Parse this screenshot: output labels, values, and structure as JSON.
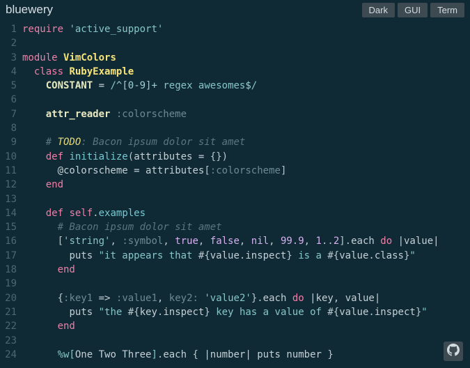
{
  "header": {
    "title": "bluewery",
    "tabs": [
      {
        "label": "Dark"
      },
      {
        "label": "GUI"
      },
      {
        "label": "Term"
      }
    ]
  },
  "code": {
    "lines": [
      {
        "n": 1,
        "t": [
          [
            "kw",
            "require"
          ],
          [
            "punc",
            " "
          ],
          [
            "str",
            "'active_support'"
          ]
        ]
      },
      {
        "n": 2,
        "t": []
      },
      {
        "n": 3,
        "t": [
          [
            "kw",
            "module"
          ],
          [
            "punc",
            " "
          ],
          [
            "cls",
            "VimColors"
          ]
        ]
      },
      {
        "n": 4,
        "t": [
          [
            "punc",
            "  "
          ],
          [
            "kw",
            "class"
          ],
          [
            "punc",
            " "
          ],
          [
            "cls",
            "RubyExample"
          ]
        ]
      },
      {
        "n": 5,
        "t": [
          [
            "punc",
            "    "
          ],
          [
            "mac",
            "CONSTANT"
          ],
          [
            "punc",
            " "
          ],
          [
            "id",
            "="
          ],
          [
            "punc",
            " "
          ],
          [
            "rgx",
            "/"
          ],
          [
            "rgxi",
            "^[0-9]+"
          ],
          [
            "rgx",
            " regex awesomes"
          ],
          [
            "rgxi",
            "$"
          ],
          [
            "rgx",
            "/"
          ]
        ]
      },
      {
        "n": 6,
        "t": []
      },
      {
        "n": 7,
        "t": [
          [
            "punc",
            "    "
          ],
          [
            "mac",
            "attr_reader"
          ],
          [
            "punc",
            " "
          ],
          [
            "sym",
            ":colorscheme"
          ]
        ]
      },
      {
        "n": 8,
        "t": []
      },
      {
        "n": 9,
        "t": [
          [
            "punc",
            "    "
          ],
          [
            "cmt",
            "# "
          ],
          [
            "todo",
            "TODO"
          ],
          [
            "cmt",
            ": Bacon ipsum dolor sit amet"
          ]
        ]
      },
      {
        "n": 10,
        "t": [
          [
            "punc",
            "    "
          ],
          [
            "kw",
            "def"
          ],
          [
            "punc",
            " "
          ],
          [
            "fn",
            "initialize"
          ],
          [
            "punc",
            "("
          ],
          [
            "id",
            "attributes"
          ],
          [
            "punc",
            " "
          ],
          [
            "id",
            "="
          ],
          [
            "punc",
            " {})"
          ]
        ]
      },
      {
        "n": 11,
        "t": [
          [
            "punc",
            "      "
          ],
          [
            "id",
            "@colorscheme"
          ],
          [
            "punc",
            " "
          ],
          [
            "id",
            "="
          ],
          [
            "punc",
            " "
          ],
          [
            "id",
            "attributes"
          ],
          [
            "punc",
            "["
          ],
          [
            "sym",
            ":colorscheme"
          ],
          [
            "punc",
            "]"
          ]
        ]
      },
      {
        "n": 12,
        "t": [
          [
            "punc",
            "    "
          ],
          [
            "kw",
            "end"
          ]
        ]
      },
      {
        "n": 13,
        "t": []
      },
      {
        "n": 14,
        "t": [
          [
            "punc",
            "    "
          ],
          [
            "kw",
            "def"
          ],
          [
            "punc",
            " "
          ],
          [
            "kw",
            "self"
          ],
          [
            "punc",
            "."
          ],
          [
            "fn",
            "examples"
          ]
        ]
      },
      {
        "n": 15,
        "t": [
          [
            "punc",
            "      "
          ],
          [
            "cmt",
            "# Bacon ipsum dolor sit amet"
          ]
        ]
      },
      {
        "n": 16,
        "t": [
          [
            "punc",
            "      ["
          ],
          [
            "str",
            "'string'"
          ],
          [
            "punc",
            ", "
          ],
          [
            "sym",
            ":symbol"
          ],
          [
            "punc",
            ", "
          ],
          [
            "bool",
            "true"
          ],
          [
            "punc",
            ", "
          ],
          [
            "bool",
            "false"
          ],
          [
            "punc",
            ", "
          ],
          [
            "bool",
            "nil"
          ],
          [
            "punc",
            ", "
          ],
          [
            "num",
            "99.9"
          ],
          [
            "punc",
            ", "
          ],
          [
            "num",
            "1"
          ],
          [
            "punc",
            ".."
          ],
          [
            "num",
            "2"
          ],
          [
            "punc",
            "]."
          ],
          [
            "id",
            "each"
          ],
          [
            "punc",
            " "
          ],
          [
            "kw",
            "do"
          ],
          [
            "punc",
            " "
          ],
          [
            "pipe",
            "|"
          ],
          [
            "id",
            "value"
          ],
          [
            "pipe",
            "|"
          ]
        ]
      },
      {
        "n": 17,
        "t": [
          [
            "punc",
            "        "
          ],
          [
            "id",
            "puts"
          ],
          [
            "punc",
            " "
          ],
          [
            "str",
            "\"it appears that "
          ],
          [
            "punc",
            "#{"
          ],
          [
            "id",
            "value"
          ],
          [
            "punc",
            "."
          ],
          [
            "id",
            "inspect"
          ],
          [
            "punc",
            "}"
          ],
          [
            "str",
            " is a "
          ],
          [
            "punc",
            "#{"
          ],
          [
            "id",
            "value"
          ],
          [
            "punc",
            "."
          ],
          [
            "id",
            "class"
          ],
          [
            "punc",
            "}"
          ],
          [
            "str",
            "\""
          ]
        ]
      },
      {
        "n": 18,
        "t": [
          [
            "punc",
            "      "
          ],
          [
            "kw",
            "end"
          ]
        ]
      },
      {
        "n": 19,
        "t": []
      },
      {
        "n": 20,
        "t": [
          [
            "punc",
            "      {"
          ],
          [
            "sym",
            ":key1"
          ],
          [
            "punc",
            " "
          ],
          [
            "id",
            "=>"
          ],
          [
            "punc",
            " "
          ],
          [
            "sym",
            ":value1"
          ],
          [
            "punc",
            ", "
          ],
          [
            "sym",
            "key2:"
          ],
          [
            "punc",
            " "
          ],
          [
            "str",
            "'value2'"
          ],
          [
            "punc",
            "}."
          ],
          [
            "id",
            "each"
          ],
          [
            "punc",
            " "
          ],
          [
            "kw",
            "do"
          ],
          [
            "punc",
            " "
          ],
          [
            "pipe",
            "|"
          ],
          [
            "id",
            "key"
          ],
          [
            "punc",
            ", "
          ],
          [
            "id",
            "value"
          ],
          [
            "pipe",
            "|"
          ]
        ]
      },
      {
        "n": 21,
        "t": [
          [
            "punc",
            "        "
          ],
          [
            "id",
            "puts"
          ],
          [
            "punc",
            " "
          ],
          [
            "str",
            "\"the "
          ],
          [
            "punc",
            "#{"
          ],
          [
            "id",
            "key"
          ],
          [
            "punc",
            "."
          ],
          [
            "id",
            "inspect"
          ],
          [
            "punc",
            "}"
          ],
          [
            "str",
            " key has a value of "
          ],
          [
            "punc",
            "#{"
          ],
          [
            "id",
            "value"
          ],
          [
            "punc",
            "."
          ],
          [
            "id",
            "inspect"
          ],
          [
            "punc",
            "}"
          ],
          [
            "str",
            "\""
          ]
        ]
      },
      {
        "n": 22,
        "t": [
          [
            "punc",
            "      "
          ],
          [
            "kw",
            "end"
          ]
        ]
      },
      {
        "n": 23,
        "t": []
      },
      {
        "n": 24,
        "t": [
          [
            "punc",
            "      "
          ],
          [
            "rgx",
            "%w["
          ],
          [
            "id",
            "One Two Three"
          ],
          [
            "rgx",
            "]"
          ],
          [
            "punc",
            "."
          ],
          [
            "id",
            "each"
          ],
          [
            "punc",
            " { "
          ],
          [
            "pipe",
            "|"
          ],
          [
            "id",
            "number"
          ],
          [
            "pipe",
            "|"
          ],
          [
            "punc",
            " "
          ],
          [
            "id",
            "puts"
          ],
          [
            "punc",
            " "
          ],
          [
            "id",
            "number"
          ],
          [
            "punc",
            " }"
          ]
        ]
      }
    ]
  },
  "footer": {
    "github_label": "github-link"
  }
}
